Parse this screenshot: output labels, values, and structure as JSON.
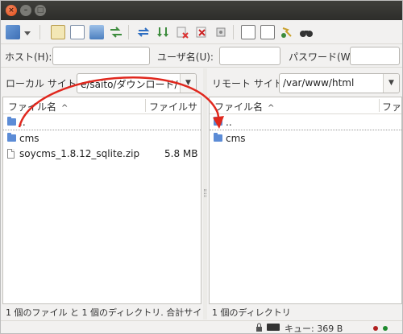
{
  "window": {
    "close_glyph": "×",
    "minimize_glyph": "–",
    "maximize_glyph": "□"
  },
  "toolbar": {
    "icons": [
      "site-manager-icon",
      "dropdown-arrow-icon",
      "message-log-icon",
      "directory-tree-icon",
      "remote-tree-icon",
      "transfer-queue-icon",
      "refresh-icon",
      "process-queue-icon",
      "cancel-icon",
      "disconnect-icon",
      "reconnect-icon",
      "directory-listing-filter-icon",
      "compare-icon",
      "sync-browse-icon",
      "find-files-icon"
    ]
  },
  "quickconnect": {
    "host_label": "ホスト(H):",
    "user_label": "ユーザ名(U):",
    "password_label": "パスワード(W",
    "host_value": "",
    "user_value": "",
    "password_value": ""
  },
  "local": {
    "site_label": "ローカル サイト:",
    "site_path": "e/saito/ダウンロード/",
    "col_name": "ファイル名",
    "col_size": "ファイルサ",
    "rows": [
      {
        "name": "..",
        "size": "",
        "kind": "parent"
      },
      {
        "name": "cms",
        "size": "",
        "kind": "folder"
      },
      {
        "name": "soycms_1.8.12_sqlite.zip",
        "size": "5.8 MB",
        "kind": "file"
      }
    ],
    "status": "1 個のファイル と 1 個のディレクトリ. 合計サイ"
  },
  "remote": {
    "site_label": "リモート サイト:",
    "site_path": "/var/www/html",
    "col_name": "ファイル名",
    "col_size": "ファイ",
    "rows": [
      {
        "name": "..",
        "kind": "parent"
      },
      {
        "name": "cms",
        "kind": "folder"
      }
    ],
    "status": "1 個のディレクトリ"
  },
  "statusbar": {
    "queue": "キュー: 369 B"
  },
  "colors": {
    "accent": "#f07746",
    "annotation_arrow": "#e0281e",
    "folder": "#5c8cd6"
  }
}
